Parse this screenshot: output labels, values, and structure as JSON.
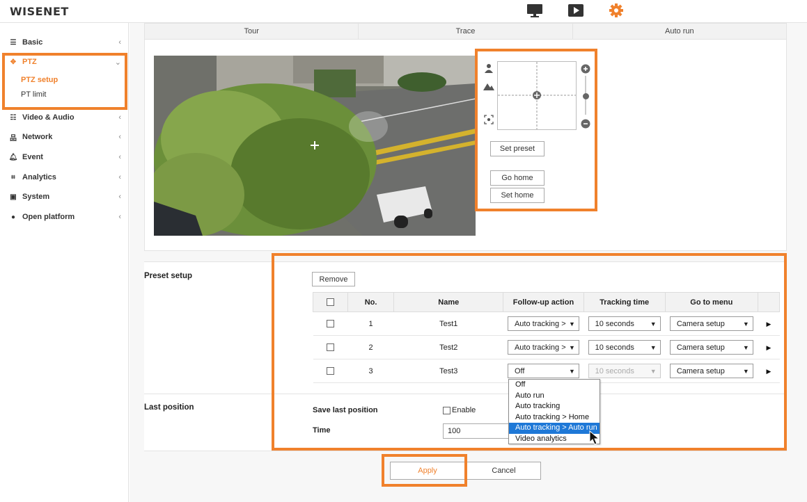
{
  "header": {
    "logo": "WISENET",
    "icons": [
      "monitor-icon",
      "play-icon",
      "gear-icon"
    ],
    "accent": "#f0812c"
  },
  "sidebar": {
    "items": [
      {
        "label": "Basic",
        "icon": "list-icon"
      },
      {
        "label": "PTZ",
        "icon": "move-icon",
        "expanded": true,
        "sub": [
          "PTZ setup",
          "PT limit"
        ]
      },
      {
        "label": "Video & Audio",
        "icon": "sliders-icon"
      },
      {
        "label": "Network",
        "icon": "network-icon"
      },
      {
        "label": "Event",
        "icon": "bell-icon"
      },
      {
        "label": "Analytics",
        "icon": "analytics-icon"
      },
      {
        "label": "System",
        "icon": "system-icon"
      },
      {
        "label": "Open platform",
        "icon": "platform-icon"
      }
    ]
  },
  "tabs": [
    "Tour",
    "Trace",
    "Auto run"
  ],
  "control": {
    "set_preset": "Set preset",
    "go_home": "Go home",
    "set_home": "Set home"
  },
  "preset": {
    "section_label": "Preset setup",
    "remove": "Remove",
    "columns": [
      "No.",
      "Name",
      "Follow-up action",
      "Tracking time",
      "Go to menu"
    ],
    "rows": [
      {
        "no": "1",
        "name": "Test1",
        "action": "Auto tracking >",
        "time": "10 seconds",
        "menu": "Camera setup"
      },
      {
        "no": "2",
        "name": "Test2",
        "action": "Auto tracking >",
        "time": "10 seconds",
        "menu": "Camera setup"
      },
      {
        "no": "3",
        "name": "Test3",
        "action": "Off",
        "time": "10 seconds",
        "menu": "Camera setup"
      }
    ],
    "dropdown_options": [
      "Off",
      "Auto run",
      "Auto tracking",
      "Auto tracking > Home",
      "Auto tracking > Auto run",
      "Video analytics"
    ],
    "dropdown_highlighted": "Auto tracking > Auto run"
  },
  "last_position": {
    "section_label": "Last position",
    "save_label": "Save last position",
    "enable_label": "Enable",
    "time_label": "Time",
    "time_value": "100"
  },
  "footer": {
    "apply": "Apply",
    "cancel": "Cancel"
  }
}
